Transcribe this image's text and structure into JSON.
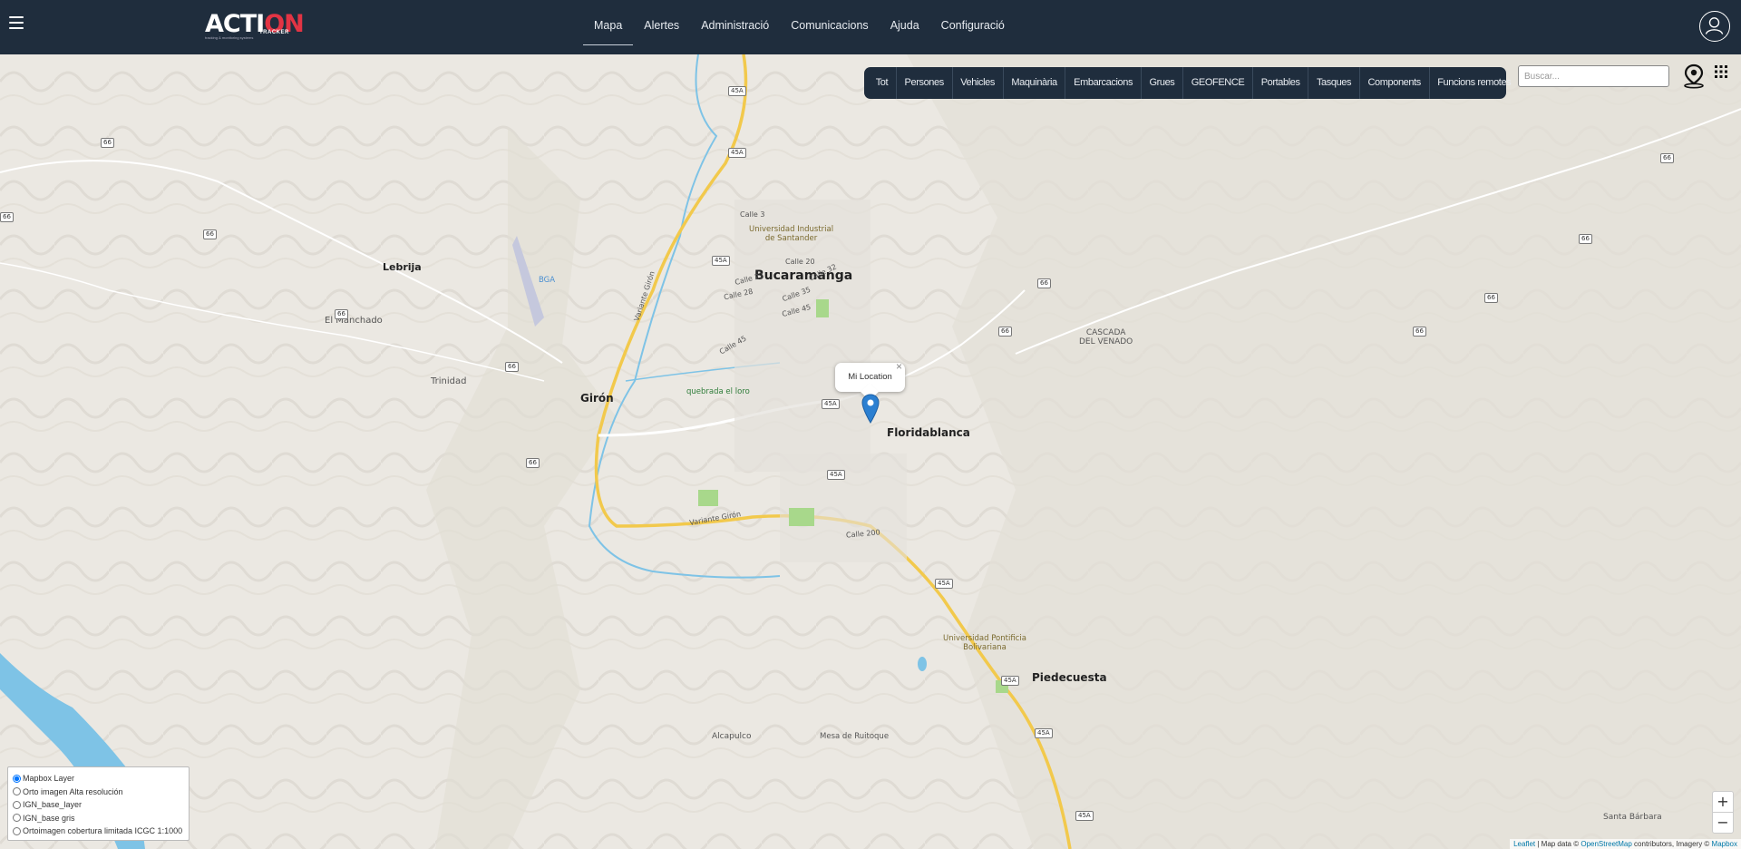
{
  "header": {
    "logo_text_a": "ACTI",
    "logo_text_b": "ON",
    "logo_sub": "TRACKER",
    "logo_tagline": "tracking & monitoring systems",
    "nav": [
      "Mapa",
      "Alertes",
      "Administració",
      "Comunicacions",
      "Ajuda",
      "Configuració"
    ],
    "active_nav": "Mapa"
  },
  "filters": [
    "Tot",
    "Persones",
    "Vehicles",
    "Maquinària",
    "Embarcacions",
    "Grues",
    "GEOFENCE",
    "Portables",
    "Tasques",
    "Components",
    "Funcions remotes"
  ],
  "search": {
    "placeholder": "Buscar..."
  },
  "map": {
    "popup": {
      "text": "Mi Location",
      "close": "×"
    },
    "places": {
      "bucaramanga": "Bucaramanga",
      "floridablanca": "Floridablanca",
      "giron": "Girón",
      "piedecuesta": "Piedecuesta",
      "lebrija": "Lebrija",
      "el_manchado": "El Manchado",
      "trinidad": "Trinidad",
      "cascada": "CASCADA",
      "del_venado": "DEL VENADO",
      "alcapulco": "Alcapulco",
      "mesa_ruitoque": "Mesa de Ruitoque",
      "santa_barbara": "Santa Bárbara",
      "uis_1": "Universidad Industrial",
      "uis_2": "de Santander",
      "upb_1": "Universidad Pontificia",
      "upb_2": "Bolivariana",
      "quebrada": "quebrada el loro",
      "bga": "BGA",
      "variante_giron": "Variante Girón",
      "calle_3": "Calle 3",
      "calle_20": "Calle 20",
      "calle_22": "Calle 22",
      "calle_32": "Calle 32",
      "calle_28": "Calle 28",
      "calle_35": "Calle 35",
      "calle_45": "Calle 45",
      "calle_45b": "Calle 45",
      "calle_200": "Calle 200"
    },
    "shields": {
      "r45a": "45A",
      "r66": "66"
    }
  },
  "layers": [
    {
      "label": "Mapbox Layer",
      "checked": true
    },
    {
      "label": "Orto imagen Alta resolución",
      "checked": false
    },
    {
      "label": "IGN_base_layer",
      "checked": false
    },
    {
      "label": "IGN_base gris",
      "checked": false
    },
    {
      "label": "Ortoimagen cobertura limitada ICGC 1:1000",
      "checked": false
    }
  ],
  "zoom": {
    "in": "+",
    "out": "−"
  },
  "attribution": {
    "leaflet": "Leaflet",
    "sep": " | Map data © ",
    "osm": "OpenStreetMap",
    "mid": " contributors, Imagery © ",
    "mapbox": "Mapbox"
  },
  "colors": {
    "topbar": "#1f2d3d",
    "accent_red": "#e23444",
    "road_yellow": "#f2c94c",
    "water": "#7ec3e6",
    "marker": "#2b7fd1"
  }
}
